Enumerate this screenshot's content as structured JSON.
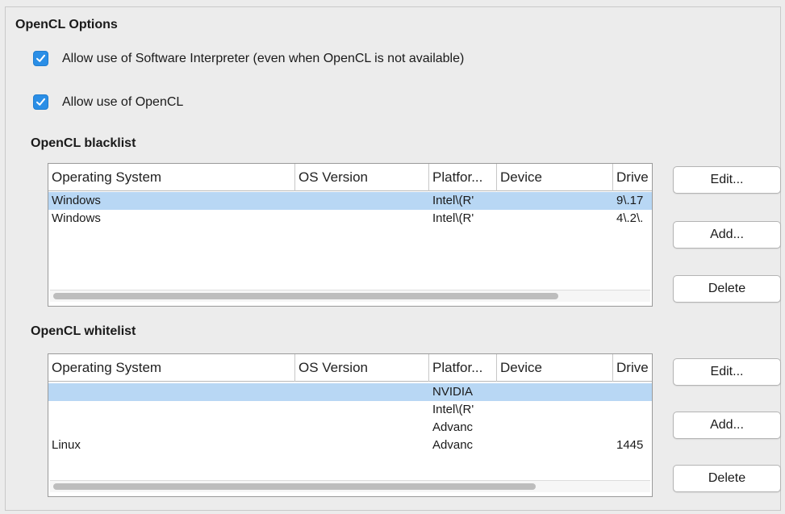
{
  "section_title": "OpenCL Options",
  "options": {
    "software_interpreter": {
      "label": "Allow use of Software Interpreter (even when OpenCL is not available)",
      "checked": true
    },
    "use_opencl": {
      "label": "Allow use of OpenCL",
      "checked": true
    }
  },
  "blacklist": {
    "title": "OpenCL blacklist",
    "columns": [
      "Operating System",
      "OS Version",
      "Platfor...",
      "Device",
      "Drive"
    ],
    "rows": [
      {
        "os": "Windows",
        "os_version": "",
        "platform": "Intel\\(R'",
        "device": "",
        "driver": "9\\.17",
        "selected": true
      },
      {
        "os": "Windows",
        "os_version": "",
        "platform": "Intel\\(R'",
        "device": "",
        "driver": "4\\.2\\.",
        "selected": false
      }
    ],
    "buttons": {
      "edit": "Edit...",
      "add": "Add...",
      "delete": "Delete"
    }
  },
  "whitelist": {
    "title": "OpenCL whitelist",
    "columns": [
      "Operating System",
      "OS Version",
      "Platfor...",
      "Device",
      "Drive"
    ],
    "rows": [
      {
        "os": "",
        "os_version": "",
        "platform": "NVIDIA",
        "device": "",
        "driver": "",
        "selected": true
      },
      {
        "os": "",
        "os_version": "",
        "platform": "Intel\\(R'",
        "device": "",
        "driver": "",
        "selected": false
      },
      {
        "os": "",
        "os_version": "",
        "platform": "Advanc",
        "device": "",
        "driver": "",
        "selected": false
      },
      {
        "os": "Linux",
        "os_version": "",
        "platform": "Advanc",
        "device": "",
        "driver": "1445",
        "selected": false
      }
    ],
    "buttons": {
      "edit": "Edit...",
      "add": "Add...",
      "delete": "Delete"
    }
  },
  "colors": {
    "checkbox": "#2a8ee6",
    "selection": "#b8d7f4",
    "background": "#ececec"
  }
}
